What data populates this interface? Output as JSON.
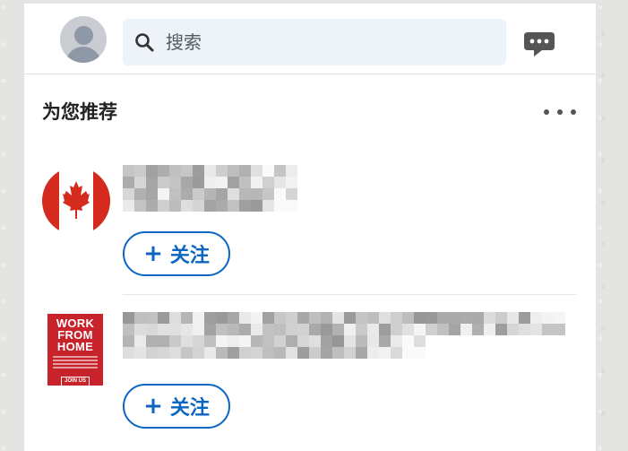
{
  "header": {
    "search_icon": "search-icon",
    "search_placeholder": "搜索",
    "messaging_icon": "chat-bubble-icon"
  },
  "section": {
    "title": "为您推荐",
    "more_icon": "more-dots-icon"
  },
  "recommendations": [
    {
      "logo_icon": "canada-flag-logo",
      "follow_label": "关注",
      "follow_icon": "plus-icon",
      "name_blurred": true
    },
    {
      "logo_text": "WORK\nFROM\nHOME",
      "logo_badge": "JOIN US",
      "follow_label": "关注",
      "follow_icon": "plus-icon",
      "name_blurred": true
    }
  ],
  "colors": {
    "accent": "#0a66c2",
    "canada_red": "#d52b1e",
    "ad_red": "#c8232b",
    "search_bg": "#edf3f8"
  }
}
